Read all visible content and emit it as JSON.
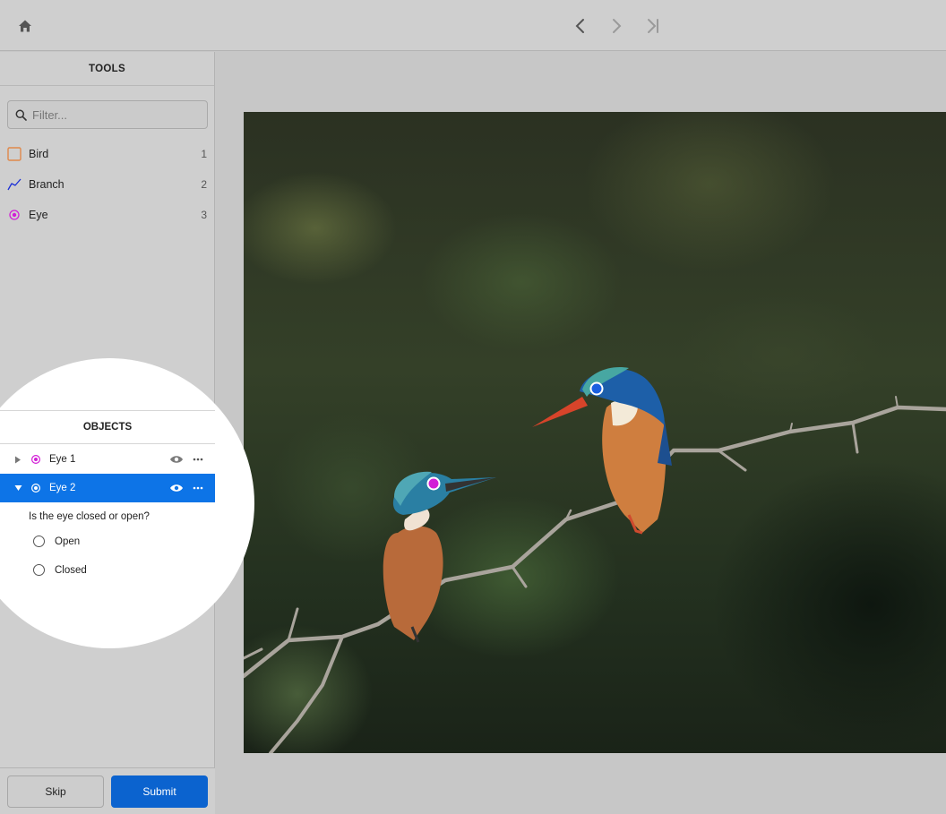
{
  "toolbar": {
    "home_icon": "home-icon",
    "prev_icon": "chevron-left-icon",
    "next_icon": "chevron-right-icon",
    "last_icon": "skip-to-end-icon"
  },
  "tools": {
    "title": "TOOLS",
    "filter_placeholder": "Filter...",
    "items": [
      {
        "label": "Bird",
        "count": "1",
        "icon": "bounding-box-icon",
        "color": "#e0884a"
      },
      {
        "label": "Branch",
        "count": "2",
        "icon": "polyline-icon",
        "color": "#1a2fd6"
      },
      {
        "label": "Eye",
        "count": "3",
        "icon": "point-icon",
        "color": "#d21fd6"
      }
    ]
  },
  "objects": {
    "title": "OBJECTS",
    "items": [
      {
        "label": "Eye 1",
        "expanded": false,
        "selected": false,
        "color": "#d21fd6"
      },
      {
        "label": "Eye 2",
        "expanded": true,
        "selected": true,
        "color": "#0d74e7"
      }
    ],
    "question": "Is the eye closed or open?",
    "options": [
      "Open",
      "Closed"
    ]
  },
  "footer": {
    "skip_label": "Skip",
    "submit_label": "Submit"
  },
  "colors": {
    "accent": "#0d74e7",
    "submit": "#0b63cf",
    "eye1_point": "#d21fd6",
    "eye2_point": "#1a5fe0"
  }
}
